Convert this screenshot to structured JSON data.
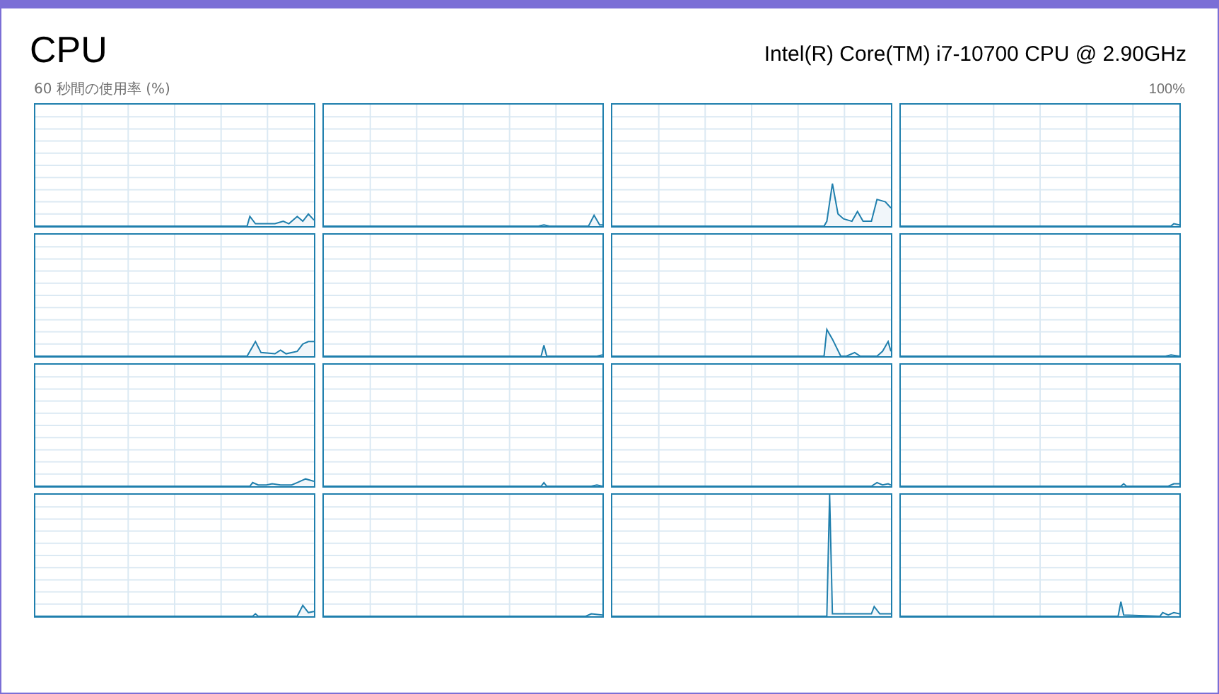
{
  "title": "CPU",
  "processor": "Intel(R) Core(TM) i7-10700 CPU @ 2.90GHz",
  "axis_caption": "60 秒間の使用率 (%)",
  "max_label": "100%",
  "graphs": [
    {
      "kind": "cpu-usage"
    },
    {
      "kind": "cpu-usage"
    },
    {
      "kind": "cpu-usage"
    },
    {
      "kind": "cpu-usage"
    },
    {
      "kind": "cpu-usage"
    },
    {
      "kind": "cpu-usage"
    },
    {
      "kind": "cpu-usage"
    },
    {
      "kind": "cpu-usage"
    },
    {
      "kind": "cpu-usage"
    },
    {
      "kind": "cpu-usage"
    },
    {
      "kind": "cpu-usage"
    },
    {
      "kind": "cpu-usage"
    },
    {
      "kind": "cpu-usage"
    },
    {
      "kind": "cpu-usage"
    },
    {
      "kind": "cpu-usage"
    },
    {
      "kind": "cpu-usage"
    }
  ]
}
